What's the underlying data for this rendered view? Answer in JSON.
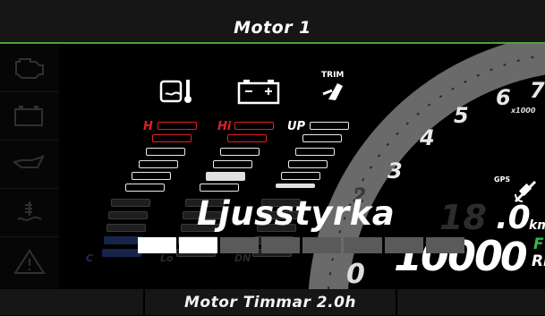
{
  "header": {
    "title": "Motor 1"
  },
  "sidebar": {
    "items": [
      {
        "icon": "engine-warning-icon"
      },
      {
        "icon": "battery-warning-icon"
      },
      {
        "icon": "oil-pressure-icon"
      },
      {
        "icon": "coolant-temp-icon"
      },
      {
        "icon": "warning-triangle-icon"
      }
    ]
  },
  "indicators": {
    "temp": {
      "icon": "engine-temp-icon",
      "high_label": "H",
      "low_label": "C"
    },
    "battery": {
      "icon": "battery-icon",
      "high_label": "Hi",
      "low_label": "Lo"
    },
    "trim": {
      "icon": "trim-icon",
      "icon_text": "TRIM",
      "up_label": "UP",
      "down_label": "DN"
    }
  },
  "gauge": {
    "tick_labels": [
      "3",
      "4",
      "5",
      "6",
      "7"
    ],
    "scale_label": "x1000",
    "low_digit": "0",
    "left_digit": "2"
  },
  "speed": {
    "value": ".0",
    "unit": "kmh",
    "ghost_digits": "18",
    "gps_label": "GPS"
  },
  "rpm": {
    "value": "0",
    "ghost_digits": "1000",
    "gear": "F",
    "unit": "RPM"
  },
  "overlay": {
    "title": "Ljusstyrka",
    "brightness_level": 2,
    "brightness_steps": 8
  },
  "footer": {
    "text": "Motor Timmar 2.0h"
  },
  "colors": {
    "accent": "#4fa337",
    "alarm": "#e02020",
    "gear": "#35b84a"
  }
}
